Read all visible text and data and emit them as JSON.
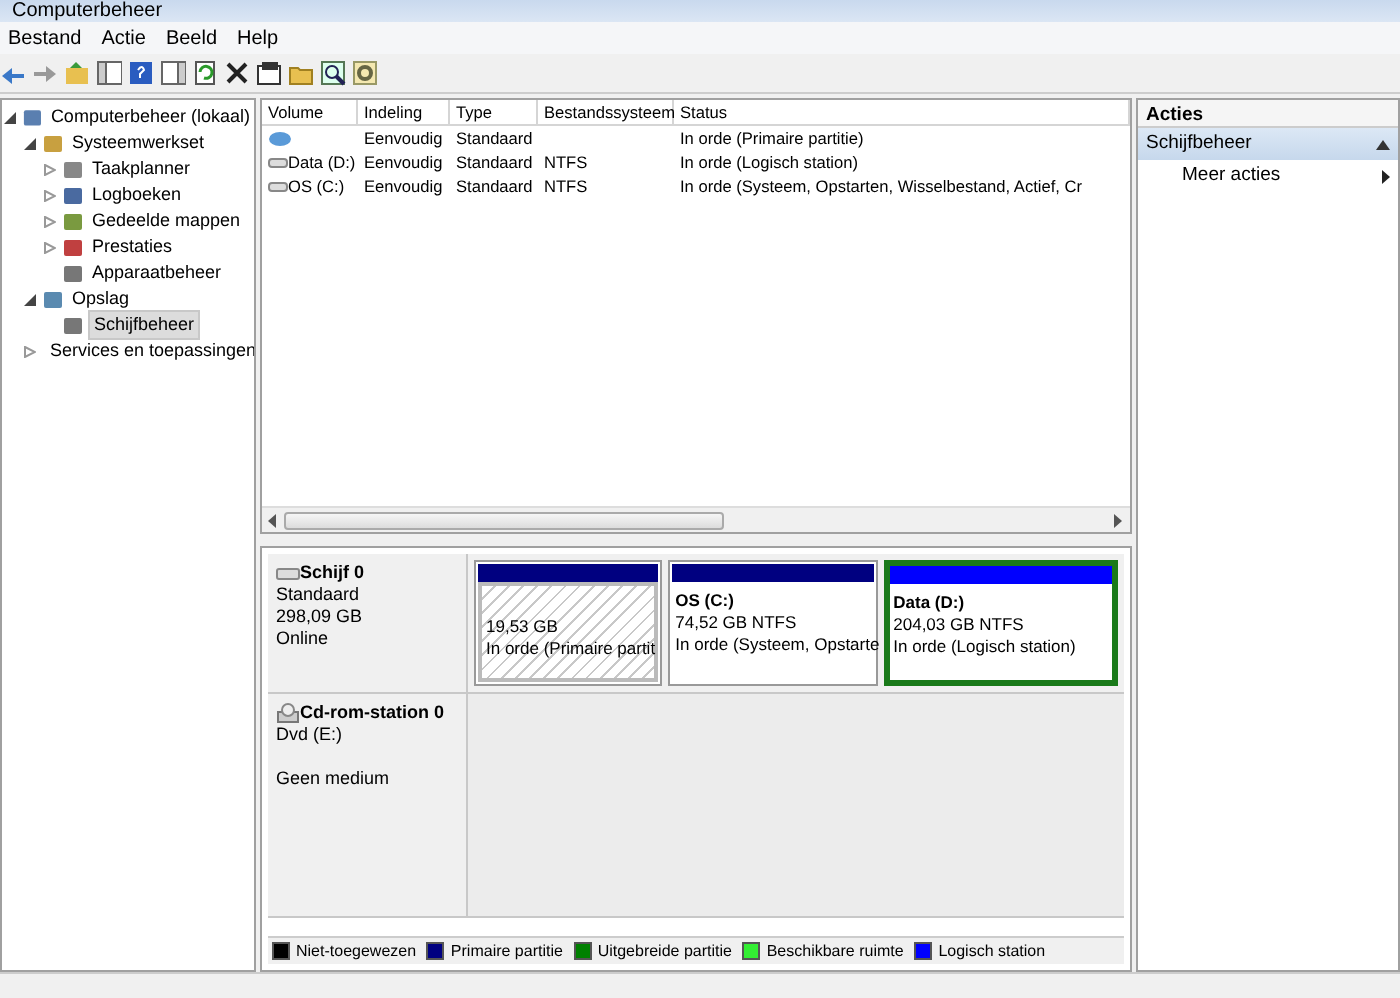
{
  "window": {
    "title": "Computerbeheer"
  },
  "menu": [
    "Bestand",
    "Actie",
    "Beeld",
    "Help"
  ],
  "tree": [
    {
      "label": "Computerbeheer (lokaal)",
      "expanded": true,
      "selected": false,
      "children": [
        {
          "label": "Systeemwerkset",
          "expanded": true,
          "selected": false,
          "children": [
            {
              "label": "Taakplanner",
              "expanded": false,
              "selected": false
            },
            {
              "label": "Logboeken",
              "expanded": false,
              "selected": false
            },
            {
              "label": "Gedeelde mappen",
              "expanded": false,
              "selected": false
            },
            {
              "label": "Prestaties",
              "expanded": false,
              "selected": false
            },
            {
              "label": "Apparaatbeheer",
              "selected": false
            }
          ]
        },
        {
          "label": "Opslag",
          "expanded": true,
          "selected": false,
          "children": [
            {
              "label": "Schijfbeheer",
              "selected": true
            }
          ]
        },
        {
          "label": "Services en toepassingen",
          "expanded": false,
          "selected": false
        }
      ]
    }
  ],
  "table": {
    "columns": [
      "Volume",
      "Indeling",
      "Type",
      "Bestandssysteem",
      "Status"
    ],
    "rows": [
      {
        "kind": "partition",
        "cells": [
          "",
          "Eenvoudig",
          "Standaard",
          "",
          "In orde (Primaire partitie)"
        ]
      },
      {
        "kind": "drive",
        "cells": [
          "Data (D:)",
          "Eenvoudig",
          "Standaard",
          "NTFS",
          "In orde (Logisch station)"
        ]
      },
      {
        "kind": "drive",
        "cells": [
          "OS (C:)",
          "Eenvoudig",
          "Standaard",
          "NTFS",
          "In orde (Systeem, Opstarten, Wisselbestand, Actief, Cr"
        ]
      }
    ]
  },
  "disks": [
    {
      "kind": "disk",
      "name": "Schijf 0",
      "lines": [
        "Standaard",
        "298,09 GB",
        "Online"
      ],
      "partitions": [
        {
          "kind": "hatched",
          "color": "#000080",
          "selected": false,
          "size": "19,53 GB",
          "status": "In orde (Primaire partit"
        },
        {
          "kind": "plain",
          "color": "#000080",
          "selected": false,
          "title": "OS  (C:)",
          "size": "74,52 GB NTFS",
          "status": "In orde (Systeem, Opstartе"
        },
        {
          "kind": "plain",
          "color": "#0000ff",
          "selected": true,
          "title": "Data  (D:)",
          "size": "204,03 GB NTFS",
          "status": "In orde (Logisch station)"
        }
      ]
    },
    {
      "kind": "cdrom",
      "name": "Cd-rom-station 0",
      "lines": [
        "Dvd (E:)",
        "Geen medium"
      ]
    }
  ],
  "legend": [
    {
      "label": "Niet-toegewezen",
      "color": "#000000"
    },
    {
      "label": "Primaire partitie",
      "color": "#000080"
    },
    {
      "label": "Uitgebreide partitie",
      "color": "#008000"
    },
    {
      "label": "Beschikbare ruimte",
      "color": "#33ee33"
    },
    {
      "label": "Logisch station",
      "color": "#0000ff"
    }
  ],
  "actions": {
    "header": "Acties",
    "sections": [
      {
        "title": "Schijfbeheer",
        "expanded": true,
        "items": [
          "Meer acties"
        ]
      }
    ]
  }
}
